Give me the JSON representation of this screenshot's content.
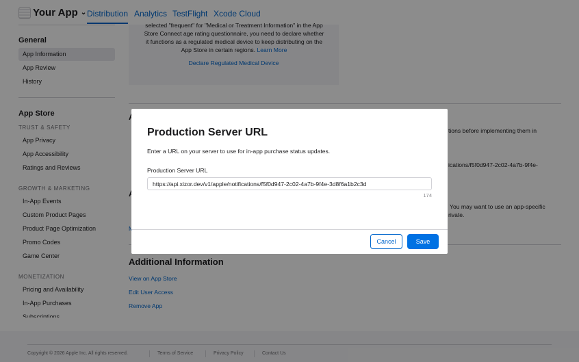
{
  "header": {
    "app_name": "Your App",
    "tabs": [
      {
        "label": "Distribution",
        "active": true
      },
      {
        "label": "Analytics"
      },
      {
        "label": "TestFlight"
      },
      {
        "label": "Xcode Cloud"
      }
    ]
  },
  "sidebar": {
    "general_heading": "General",
    "general_items": [
      "App Information",
      "App Review",
      "History"
    ],
    "app_store_heading": "App Store",
    "trust_safety_heading": "TRUST & SAFETY",
    "trust_safety_items": [
      "App Privacy",
      "App Accessibility",
      "Ratings and Reviews"
    ],
    "growth_heading": "GROWTH & MARKETING",
    "growth_items": [
      "In-App Events",
      "Custom Product Pages",
      "Product Page Optimization",
      "Promo Codes",
      "Game Center"
    ],
    "monetization_heading": "MONETIZATION",
    "monetization_items": [
      "Pricing and Availability",
      "In-App Purchases",
      "Subscriptions"
    ]
  },
  "main": {
    "notice_line1": "selected \"frequent\" for \"Medical or Treatment Information\" in the App",
    "notice_line2": "Store Connect age rating questionnaire, you need to declare whether",
    "notice_line3": "it functions as a regulated medical device to keep distributing on the",
    "notice_line4": "App Store in certain regions.",
    "learn_more": "Learn More",
    "declare_link": "Declare Regulated Medical Device",
    "frag_1": "A",
    "frag_2": "tions before implementing them in",
    "frag_3": "ications/f5f0d947-2c02-4a7b-9f4e-",
    "frag_4": "A",
    "frag_5": "You may want to use an app-specific",
    "frag_6": "rivate.",
    "frag_7": "M",
    "additional_heading": "Additional Information",
    "links": [
      "View on App Store",
      "Edit User Access",
      "Remove App"
    ]
  },
  "modal": {
    "title": "Production Server URL",
    "description": "Enter a URL on your server to use for in-app purchase status updates.",
    "field_label": "Production Server URL",
    "url_value": "https://api.xizor.dev/v1/apple/notifications/f5f0d947-2c02-4a7b-9f4e-3d8f6a1b2c3d",
    "char_count": "174",
    "cancel_label": "Cancel",
    "save_label": "Save"
  },
  "footer": {
    "copyright": "Copyright © 2026 Apple Inc. All rights reserved.",
    "terms": "Terms of Service",
    "privacy": "Privacy Policy",
    "contact": "Contact Us"
  }
}
